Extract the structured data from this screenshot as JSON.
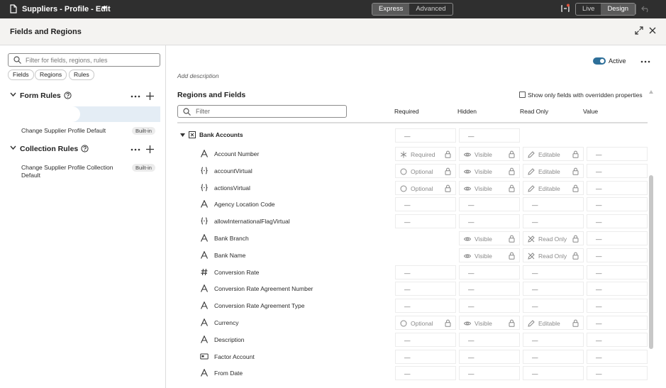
{
  "app": {
    "title": "Suppliers - Profile - Edit",
    "modes": [
      "Express",
      "Advanced"
    ],
    "active_mode": "Express",
    "views": [
      "Live",
      "Design"
    ],
    "active_view": "Design"
  },
  "panel": {
    "title": "Fields and Regions"
  },
  "left": {
    "search_placeholder": "Filter for fields, regions, rules",
    "chips": [
      "Fields",
      "Regions",
      "Rules"
    ],
    "form_rules": {
      "title": "Form Rules",
      "items": [
        {
          "name": "Change Supplier Profile Default",
          "badge": "Built-in"
        }
      ]
    },
    "collection_rules": {
      "title": "Collection Rules",
      "items": [
        {
          "name": "Change Supplier Profile Collection Default",
          "badge": "Built-in"
        }
      ]
    }
  },
  "main": {
    "active_label": "Active",
    "add_description": "Add description",
    "title": "Regions and Fields",
    "overridden_label": "Show only fields with overridden properties",
    "filter_placeholder": "Filter",
    "columns": [
      "Required",
      "Hidden",
      "Read Only",
      "Value"
    ],
    "group": {
      "label": "Bank Accounts",
      "required": "—",
      "hidden": "—"
    },
    "fields": [
      {
        "icon": "text-icon",
        "label": "Account Number",
        "required": {
          "kind": "required",
          "text": "Required"
        },
        "hidden": {
          "kind": "visible",
          "text": "Visible"
        },
        "readonly": {
          "kind": "editable",
          "text": "Editable"
        },
        "value": "—"
      },
      {
        "icon": "braces-icon",
        "label": "accountVirtual",
        "required": {
          "kind": "optional",
          "text": "Optional"
        },
        "hidden": {
          "kind": "visible",
          "text": "Visible"
        },
        "readonly": {
          "kind": "editable",
          "text": "Editable"
        },
        "value": "—"
      },
      {
        "icon": "braces-icon",
        "label": "actionsVirtual",
        "required": {
          "kind": "optional",
          "text": "Optional"
        },
        "hidden": {
          "kind": "visible",
          "text": "Visible"
        },
        "readonly": {
          "kind": "editable",
          "text": "Editable"
        },
        "value": "—"
      },
      {
        "icon": "text-icon",
        "label": "Agency Location Code",
        "required": {
          "kind": "dash",
          "text": "—"
        },
        "hidden": {
          "kind": "dash",
          "text": "—"
        },
        "readonly": {
          "kind": "dash",
          "text": "—"
        },
        "value": "—"
      },
      {
        "icon": "braces-icon",
        "label": "allowInternationalFlagVirtual",
        "required": {
          "kind": "dash",
          "text": "—"
        },
        "hidden": {
          "kind": "dash",
          "text": "—"
        },
        "readonly": {
          "kind": "dash",
          "text": "—"
        },
        "value": "—"
      },
      {
        "icon": "text-icon",
        "label": "Bank Branch",
        "required": {
          "kind": "empty",
          "text": ""
        },
        "hidden": {
          "kind": "visible",
          "text": "Visible"
        },
        "readonly": {
          "kind": "readonly",
          "text": "Read Only"
        },
        "value": "—"
      },
      {
        "icon": "text-icon",
        "label": "Bank Name",
        "required": {
          "kind": "empty",
          "text": ""
        },
        "hidden": {
          "kind": "visible",
          "text": "Visible"
        },
        "readonly": {
          "kind": "readonly",
          "text": "Read Only"
        },
        "value": "—"
      },
      {
        "icon": "number-icon",
        "label": "Conversion Rate",
        "required": {
          "kind": "dash",
          "text": "—"
        },
        "hidden": {
          "kind": "dash",
          "text": "—"
        },
        "readonly": {
          "kind": "dash",
          "text": "—"
        },
        "value": "—"
      },
      {
        "icon": "text-icon",
        "label": "Conversion Rate Agreement Number",
        "required": {
          "kind": "dash",
          "text": "—"
        },
        "hidden": {
          "kind": "dash",
          "text": "—"
        },
        "readonly": {
          "kind": "dash",
          "text": "—"
        },
        "value": "—"
      },
      {
        "icon": "text-icon",
        "label": "Conversion Rate Agreement Type",
        "required": {
          "kind": "dash",
          "text": "—"
        },
        "hidden": {
          "kind": "dash",
          "text": "—"
        },
        "readonly": {
          "kind": "dash",
          "text": "—"
        },
        "value": "—"
      },
      {
        "icon": "text-icon",
        "label": "Currency",
        "required": {
          "kind": "optional",
          "text": "Optional"
        },
        "hidden": {
          "kind": "visible",
          "text": "Visible"
        },
        "readonly": {
          "kind": "editable",
          "text": "Editable"
        },
        "value": "—"
      },
      {
        "icon": "text-icon",
        "label": "Description",
        "required": {
          "kind": "dash",
          "text": "—"
        },
        "hidden": {
          "kind": "dash",
          "text": "—"
        },
        "readonly": {
          "kind": "dash",
          "text": "—"
        },
        "value": "—"
      },
      {
        "icon": "card-icon",
        "label": "Factor Account",
        "required": {
          "kind": "dash",
          "text": "—"
        },
        "hidden": {
          "kind": "dash",
          "text": "—"
        },
        "readonly": {
          "kind": "dash",
          "text": "—"
        },
        "value": "—"
      },
      {
        "icon": "text-icon",
        "label": "From Date",
        "required": {
          "kind": "dash",
          "text": "—"
        },
        "hidden": {
          "kind": "dash",
          "text": "—"
        },
        "readonly": {
          "kind": "dash",
          "text": "—"
        },
        "value": "—"
      }
    ]
  }
}
